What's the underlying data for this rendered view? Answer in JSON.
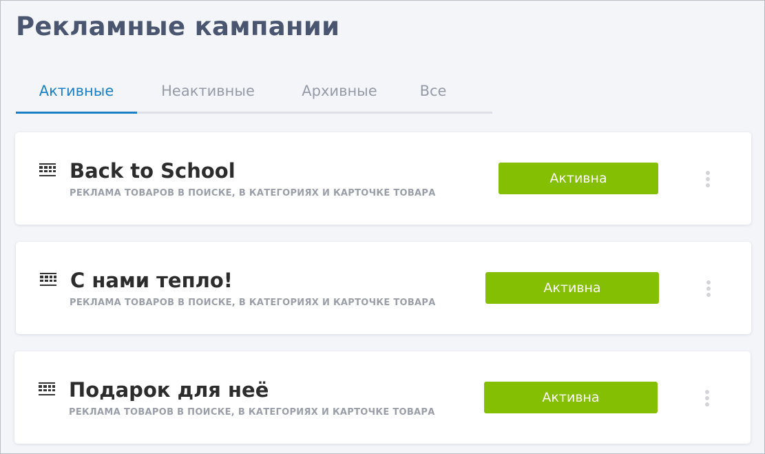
{
  "page": {
    "title": "Рекламные кампании"
  },
  "tabs": [
    {
      "label": "Активные",
      "active": true
    },
    {
      "label": "Неактивные",
      "active": false
    },
    {
      "label": "Архивные",
      "active": false
    },
    {
      "label": "Все",
      "active": false
    }
  ],
  "campaigns": [
    {
      "title": "Back to School",
      "subtitle": "РЕКЛАМА ТОВАРОВ В ПОИСКЕ, В КАТЕГОРИЯХ И КАРТОЧКЕ ТОВАРА",
      "status": "Активна",
      "icon": "campaign-icon"
    },
    {
      "title": "С нами тепло!",
      "subtitle": "РЕКЛАМА ТОВАРОВ В ПОИСКЕ, В КАТЕГОРИЯХ И КАРТОЧКЕ ТОВАРА",
      "status": "Активна",
      "icon": "campaign-icon"
    },
    {
      "title": "Подарок для неё",
      "subtitle": "РЕКЛАМА ТОВАРОВ В ПОИСКЕ, В КАТЕГОРИЯХ И КАРТОЧКЕ ТОВАРА",
      "status": "Активна",
      "icon": "campaign-icon"
    }
  ],
  "colors": {
    "background": "#f4f5f9",
    "title": "#4a5670",
    "tab_active": "#1a7fc4",
    "tab_inactive": "#959aa7",
    "status_active": "#85bf03",
    "card": "#ffffff"
  }
}
